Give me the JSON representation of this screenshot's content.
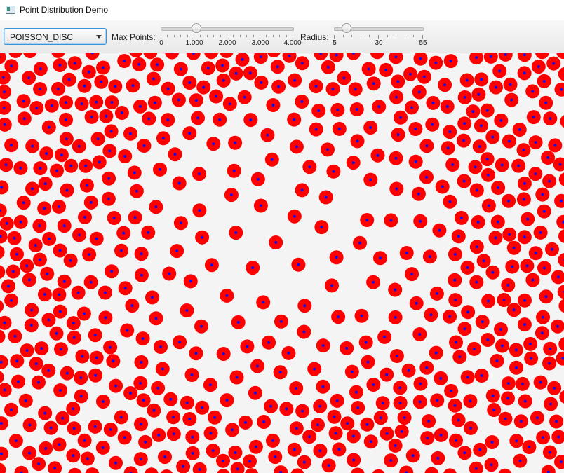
{
  "window": {
    "title": "Point Distribution Demo"
  },
  "toolbar": {
    "mode_select": {
      "value": "POISSON_DISC"
    },
    "max_points": {
      "label": "Max Points:",
      "value": 1000,
      "min": 0,
      "max": 4000,
      "tick_labels": [
        "0",
        "1.000",
        "2.000",
        "3.000",
        "4.000"
      ]
    },
    "radius": {
      "label": "Radius:",
      "value": 10,
      "min": 5,
      "max": 55,
      "tick_labels": [
        "5",
        "30",
        "55"
      ]
    }
  },
  "canvas": {
    "point_fill": "#ff0000",
    "point_center": "#1010ee",
    "background": "#f4f4f4"
  }
}
